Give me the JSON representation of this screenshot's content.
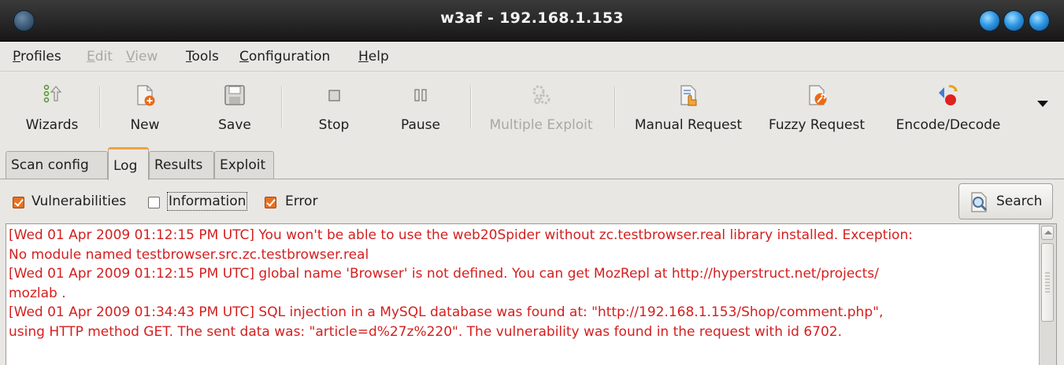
{
  "window": {
    "title": "w3af - 192.168.1.153"
  },
  "menu": [
    {
      "label": "Profiles",
      "enabled": true
    },
    {
      "label": "Edit",
      "enabled": false
    },
    {
      "label": "View",
      "enabled": false
    },
    {
      "label": "Tools",
      "enabled": true
    },
    {
      "label": "Configuration",
      "enabled": true
    },
    {
      "label": "Help",
      "enabled": true
    }
  ],
  "toolbar": {
    "wizards": "Wizards",
    "new": "New",
    "save": "Save",
    "stop": "Stop",
    "pause": "Pause",
    "multiple_exploit": "Multiple Exploit",
    "manual_request": "Manual Request",
    "fuzzy_request": "Fuzzy Request",
    "encode_decode": "Encode/Decode"
  },
  "tabs": [
    {
      "label": "Scan config",
      "active": false
    },
    {
      "label": "Log",
      "active": true
    },
    {
      "label": "Results",
      "active": false
    },
    {
      "label": "Exploit",
      "active": false
    }
  ],
  "filters": {
    "vulnerabilities": {
      "label": "Vulnerabilities",
      "checked": true
    },
    "information": {
      "label": "Information",
      "checked": false
    },
    "error": {
      "label": "Error",
      "checked": true
    }
  },
  "search_label": "Search",
  "log_color": "#d41f1f",
  "log_lines": [
    "[Wed 01 Apr 2009 01:12:15 PM UTC] You won't be able to use the web20Spider without zc.testbrowser.real library installed. Exception:",
    "No module named testbrowser.src.zc.testbrowser.real",
    "[Wed 01 Apr 2009 01:12:15 PM UTC] global name 'Browser' is not defined. You can get MozRepl at http://hyperstruct.net/projects/",
    "mozlab .",
    "[Wed 01 Apr 2009 01:34:43 PM UTC] SQL injection in a MySQL database was found at: \"http://192.168.1.153/Shop/comment.php\",",
    "using HTTP method GET. The sent data was: \"article=d%27z%220\". The vulnerability was found in the request with id 6702."
  ]
}
